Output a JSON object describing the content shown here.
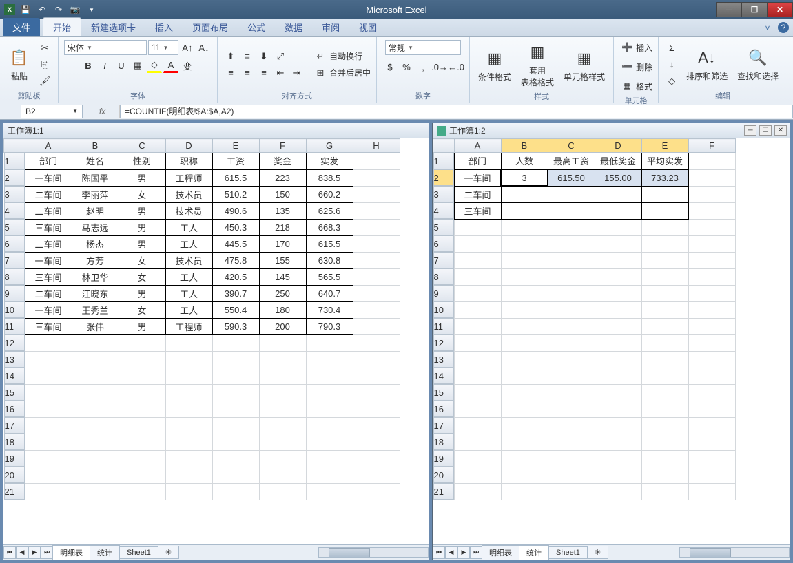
{
  "app": {
    "title": "Microsoft Excel"
  },
  "qat": {
    "save": "💾",
    "undo": "↶",
    "redo": "↷",
    "camera": "📷"
  },
  "tabs": [
    "文件",
    "开始",
    "新建选项卡",
    "插入",
    "页面布局",
    "公式",
    "数据",
    "审阅",
    "视图"
  ],
  "ribbon": {
    "clipboard": {
      "label": "剪贴板",
      "paste": "粘贴"
    },
    "font": {
      "label": "字体",
      "name": "宋体",
      "size": "11",
      "bold": "B",
      "italic": "I",
      "underline": "U"
    },
    "align": {
      "label": "对齐方式",
      "wrap": "自动换行",
      "merge": "合并后居中"
    },
    "number": {
      "label": "数字",
      "format": "常规"
    },
    "styles": {
      "label": "样式",
      "cond": "条件格式",
      "table": "套用\n表格格式",
      "cell": "单元格样式"
    },
    "cells": {
      "label": "单元格",
      "insert": "插入",
      "delete": "删除",
      "format": "格式"
    },
    "editing": {
      "label": "编辑",
      "sort": "排序和筛选",
      "find": "查找和选择"
    }
  },
  "namebox": "B2",
  "formula": "=COUNTIF(明细表!$A:$A,A2)",
  "workbook": {
    "left": {
      "title": "工作簿1:1",
      "cols": [
        "A",
        "B",
        "C",
        "D",
        "E",
        "F",
        "G",
        "H"
      ],
      "headers": [
        "部门",
        "姓名",
        "性别",
        "职称",
        "工资",
        "奖金",
        "实发"
      ],
      "rows": [
        [
          "一车间",
          "陈国平",
          "男",
          "工程师",
          "615.5",
          "223",
          "838.5"
        ],
        [
          "二车间",
          "李丽萍",
          "女",
          "技术员",
          "510.2",
          "150",
          "660.2"
        ],
        [
          "二车间",
          "赵明",
          "男",
          "技术员",
          "490.6",
          "135",
          "625.6"
        ],
        [
          "三车间",
          "马志远",
          "男",
          "工人",
          "450.3",
          "218",
          "668.3"
        ],
        [
          "二车间",
          "杨杰",
          "男",
          "工人",
          "445.5",
          "170",
          "615.5"
        ],
        [
          "一车间",
          "方芳",
          "女",
          "技术员",
          "475.8",
          "155",
          "630.8"
        ],
        [
          "三车间",
          "林卫华",
          "女",
          "工人",
          "420.5",
          "145",
          "565.5"
        ],
        [
          "二车间",
          "江晓东",
          "男",
          "工人",
          "390.7",
          "250",
          "640.7"
        ],
        [
          "一车间",
          "王秀兰",
          "女",
          "工人",
          "550.4",
          "180",
          "730.4"
        ],
        [
          "三车间",
          "张伟",
          "男",
          "工程师",
          "590.3",
          "200",
          "790.3"
        ]
      ],
      "tabs": [
        "明细表",
        "统计",
        "Sheet1"
      ]
    },
    "right": {
      "title": "工作簿1:2",
      "cols": [
        "A",
        "B",
        "C",
        "D",
        "E",
        "F"
      ],
      "headers": [
        "部门",
        "人数",
        "最高工资",
        "最低奖金",
        "平均实发"
      ],
      "rows": [
        [
          "一车间",
          "3",
          "615.50",
          "155.00",
          "733.23"
        ],
        [
          "二车间",
          "",
          "",
          "",
          ""
        ],
        [
          "三车间",
          "",
          "",
          "",
          ""
        ]
      ],
      "tabs": [
        "明细表",
        "统计",
        "Sheet1"
      ]
    }
  },
  "chart_data": {
    "type": "table",
    "title": "员工工资明细与汇总",
    "detail": {
      "columns": [
        "部门",
        "姓名",
        "性别",
        "职称",
        "工资",
        "奖金",
        "实发"
      ],
      "rows": [
        [
          "一车间",
          "陈国平",
          "男",
          "工程师",
          615.5,
          223,
          838.5
        ],
        [
          "二车间",
          "李丽萍",
          "女",
          "技术员",
          510.2,
          150,
          660.2
        ],
        [
          "二车间",
          "赵明",
          "男",
          "技术员",
          490.6,
          135,
          625.6
        ],
        [
          "三车间",
          "马志远",
          "男",
          "工人",
          450.3,
          218,
          668.3
        ],
        [
          "二车间",
          "杨杰",
          "男",
          "工人",
          445.5,
          170,
          615.5
        ],
        [
          "一车间",
          "方芳",
          "女",
          "技术员",
          475.8,
          155,
          630.8
        ],
        [
          "三车间",
          "林卫华",
          "女",
          "工人",
          420.5,
          145,
          565.5
        ],
        [
          "二车间",
          "江晓东",
          "男",
          "工人",
          390.7,
          250,
          640.7
        ],
        [
          "一车间",
          "王秀兰",
          "女",
          "工人",
          550.4,
          180,
          730.4
        ],
        [
          "三车间",
          "张伟",
          "男",
          "工程师",
          590.3,
          200,
          790.3
        ]
      ]
    },
    "summary": {
      "columns": [
        "部门",
        "人数",
        "最高工资",
        "最低奖金",
        "平均实发"
      ],
      "rows": [
        [
          "一车间",
          3,
          615.5,
          155.0,
          733.23
        ],
        [
          "二车间",
          null,
          null,
          null,
          null
        ],
        [
          "三车间",
          null,
          null,
          null,
          null
        ]
      ]
    }
  }
}
